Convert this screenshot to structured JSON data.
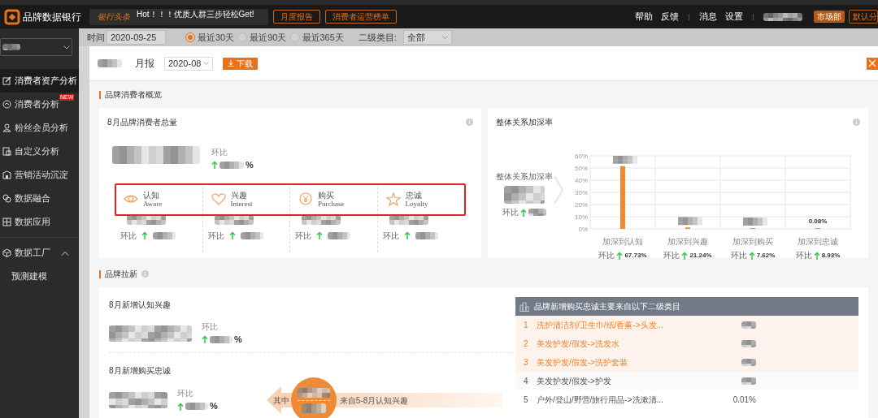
{
  "header": {
    "brand": "品牌数据银行",
    "news_label": "银行头条",
    "news_text": "Hot！！！优质人群三步轻松Get!",
    "buttons": [
      "月度报告",
      "消费者运营榜单"
    ],
    "links_left": [
      "帮助",
      "反馈"
    ],
    "links_right": [
      "消息",
      "设置"
    ],
    "department": "市场部",
    "default_button": "默认分"
  },
  "sidebar": {
    "items": [
      {
        "label": "消费者资产分析",
        "selected": true
      },
      {
        "label": "消费者分析",
        "selected": false,
        "badge": "NEW"
      },
      {
        "label": "粉丝会员分析",
        "selected": false
      },
      {
        "label": "自定义分析",
        "selected": false
      },
      {
        "label": "营销活动沉淀",
        "selected": false
      },
      {
        "label": "数据融合",
        "selected": false
      },
      {
        "label": "数据应用",
        "selected": false
      },
      {
        "label": "数据工厂",
        "selected": false,
        "expanded": true,
        "children": [
          {
            "label": "预测建模",
            "selected": false
          }
        ]
      }
    ]
  },
  "filters": {
    "time_label": "时间",
    "date": "2020-09-25",
    "ranges": [
      {
        "label": "最近30天",
        "selected": true
      },
      {
        "label": "最近90天",
        "selected": false
      },
      {
        "label": "最近365天",
        "selected": false
      }
    ],
    "category_label": "二级类目:",
    "category": "全部"
  },
  "report": {
    "period_label": "月报",
    "month": "2020-08",
    "download": "下载"
  },
  "overview": {
    "title": "品牌消费者概览",
    "total_card": {
      "title": "8月品牌消费者总量",
      "compare_label": "环比",
      "suffix": "%",
      "stages": [
        {
          "cn": "认知",
          "en": "Aware",
          "compare_label": "环比"
        },
        {
          "cn": "兴趣",
          "en": "Interest",
          "compare_label": "环比"
        },
        {
          "cn": "购买",
          "en": "Purchase",
          "compare_label": "环比"
        },
        {
          "cn": "忠诚",
          "en": "Loyalty",
          "compare_label": "环比"
        }
      ]
    },
    "rate_card": {
      "title": "整体关系加深率",
      "side_label": "整体关系加深率",
      "compare_label": "环比",
      "chart_data": {
        "type": "bar",
        "grid": true,
        "categories": [
          "加深到认知",
          "加深到兴趣",
          "加深到购买",
          "加深到忠诚"
        ],
        "values": [
          51.5,
          1.2,
          0.6,
          0.08
        ],
        "ylim": [
          0,
          60
        ],
        "yticks": [
          {
            "value": 0,
            "label": "0%"
          },
          {
            "value": 10,
            "label": "10%"
          },
          {
            "value": 20,
            "label": "20%"
          },
          {
            "value": 30,
            "label": "30%"
          },
          {
            "value": 40,
            "label": "40%"
          },
          {
            "value": 50,
            "label": "50%"
          },
          {
            "value": 60,
            "label": "60%"
          }
        ],
        "value_labels": [
          null,
          null,
          null,
          "0.08%"
        ]
      },
      "comparisons": [
        {
          "label": "环比",
          "value": "67.73%"
        },
        {
          "label": "环比",
          "value": "21.24%"
        },
        {
          "label": "环比",
          "value": "7.62%"
        },
        {
          "label": "环比",
          "value": "8.93%"
        }
      ]
    }
  },
  "acquisition": {
    "title": "品牌拉新",
    "new_interest": {
      "title": "8月新增认知兴趣",
      "compare_label": "环比",
      "suffix": "%"
    },
    "new_purchase": {
      "title": "8月新增购买忠诚",
      "compare_label": "环比",
      "suffix": "%",
      "among": "其中",
      "source": "来自5-8月认知兴趣"
    },
    "table": {
      "title": "品牌新增购买忠诚主要来自以下二级类目",
      "rows": [
        {
          "rank": "1",
          "category": "洗护清洁剂/卫生巾/纸/香薰->头发...",
          "highlighted": true
        },
        {
          "rank": "2",
          "category": "美发护发/假发->洗发水",
          "highlighted": true
        },
        {
          "rank": "3",
          "category": "美发护发/假发->洗护套装",
          "highlighted": true
        },
        {
          "rank": "4",
          "category": "美发护发/假发->护发",
          "highlighted": false
        },
        {
          "rank": "5",
          "category": "户外/登山/野营/旅行用品->洗漱清...",
          "highlighted": false,
          "share": "0.01%"
        }
      ]
    }
  }
}
